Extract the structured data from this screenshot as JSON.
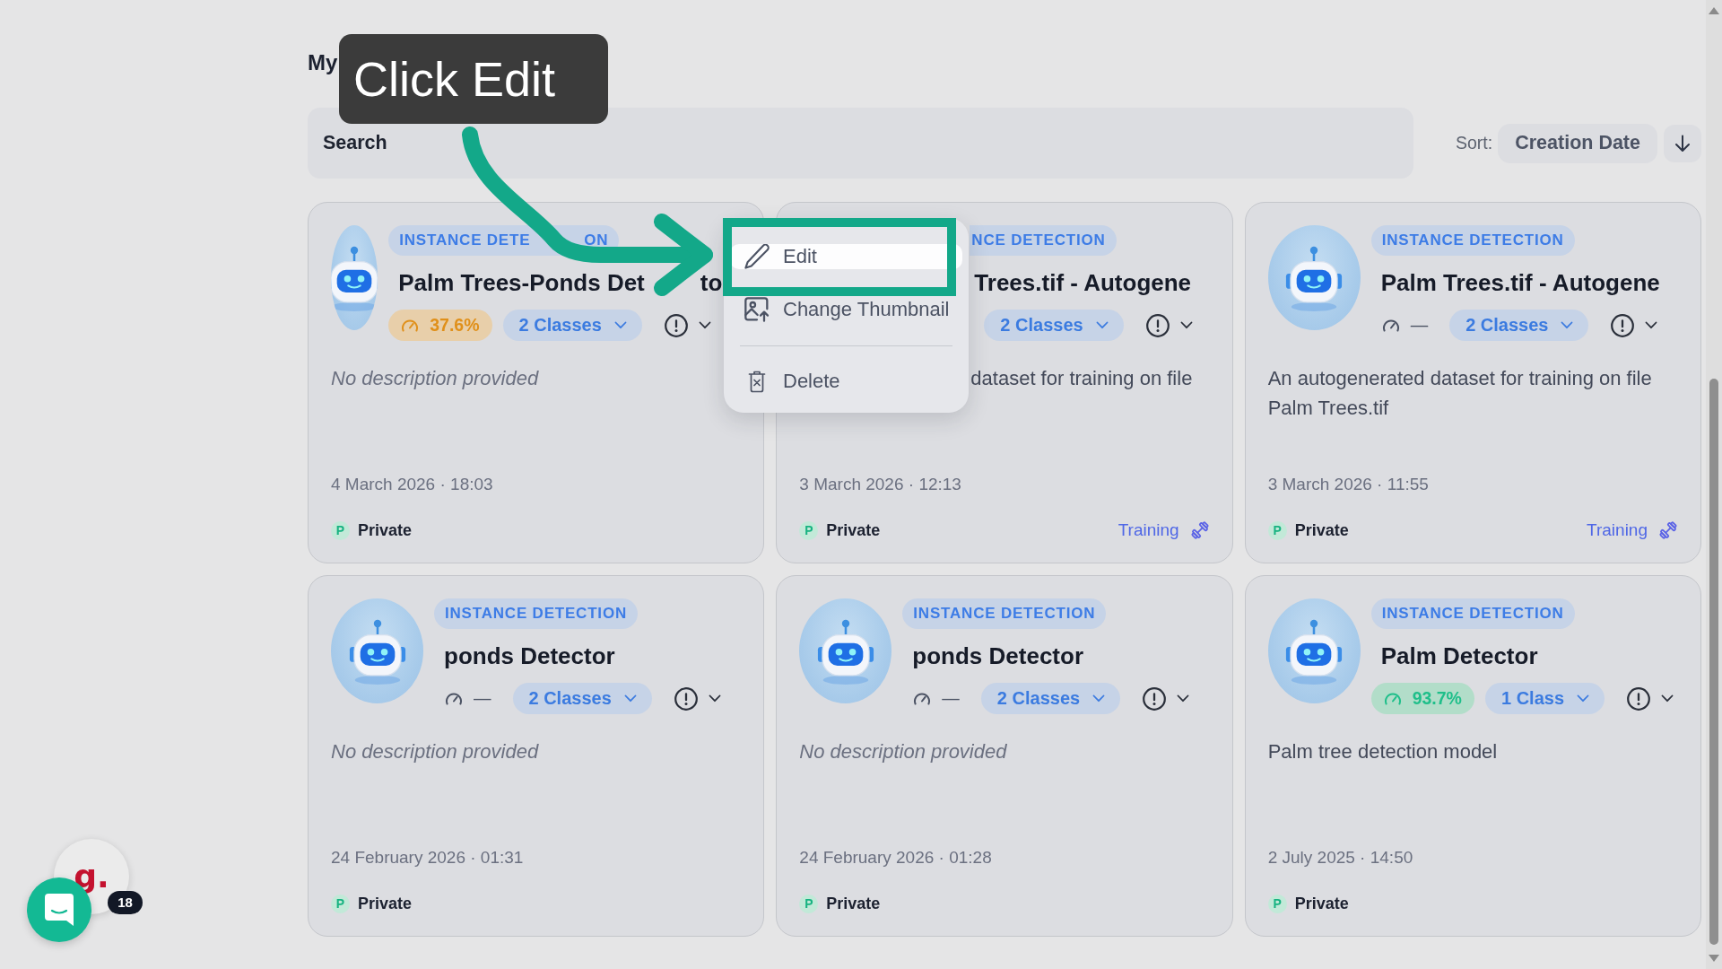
{
  "page": {
    "title": "My"
  },
  "search": {
    "placeholder": "Search"
  },
  "sort": {
    "label": "Sort:",
    "value": "Creation Date",
    "descending": true
  },
  "models": [
    {
      "type": [
        "INSTANCE DETE",
        "ON"
      ],
      "name": [
        "Palm Trees-Ponds Det",
        "to"
      ],
      "accuracy": "37.6%",
      "color": "#e0901a",
      "classes": "2 Classes",
      "description": "No description provided",
      "description_empty": true,
      "created": "4 March 2026 · 18:03",
      "visibility": {
        "initial": "P",
        "label": "Private"
      },
      "menu": {
        "groups": [
          {
            "items": [
              {
                "kind": "edit",
                "label": "Edit",
                "selected": true
              },
              {
                "kind": "thumbnail",
                "label": "Change Thumbnail",
                "selected": false
              }
            ]
          },
          {
            "items": [
              {
                "kind": "delete",
                "label": "Delete",
                "selected": false
              }
            ]
          }
        ]
      }
    },
    {
      "type": "NCE DETECTION",
      "name": "Trees.tif - Autogene",
      "classes": "2 Classes",
      "description": "dataset for training on file",
      "description_empty": false,
      "created": "3 March 2026 · 12:13",
      "visibility": {
        "initial": "P",
        "label": "Private"
      },
      "status": "Training"
    },
    {
      "type": "INSTANCE DETECTION",
      "name": "Palm Trees.tif - Autogene",
      "accuracy": "—",
      "classes": "2 Classes",
      "description": "An autogenerated dataset for training on file Palm Trees.tif",
      "description_empty": false,
      "created": "3 March 2026 · 11:55",
      "visibility": {
        "initial": "P",
        "label": "Private"
      },
      "status": "Training"
    },
    {
      "type": "INSTANCE DETECTION",
      "name": "ponds Detector",
      "accuracy": "—",
      "classes": "2 Classes",
      "description": "No description provided",
      "description_empty": true,
      "created": "24 February 2026 · 01:31",
      "visibility": {
        "initial": "P",
        "label": "Private"
      }
    },
    {
      "type": "INSTANCE DETECTION",
      "name": "ponds Detector",
      "accuracy": "—",
      "classes": "2 Classes",
      "description": "No description provided",
      "description_empty": true,
      "created": "24 February 2026 · 01:28",
      "visibility": {
        "initial": "P",
        "label": "Private"
      }
    },
    {
      "type": "INSTANCE DETECTION",
      "name": "Palm Detector",
      "accuracy": "93.7%",
      "color": "#1fbf8a",
      "classes": "1 Class",
      "description": "Palm tree detection model",
      "description_empty": false,
      "created": "2 July 2025 · 14:50",
      "visibility": {
        "initial": "P",
        "label": "Private"
      }
    }
  ],
  "tutorial": {
    "tooltip": "Click Edit"
  },
  "launcher": {
    "logo": "g.",
    "badge": "18"
  }
}
